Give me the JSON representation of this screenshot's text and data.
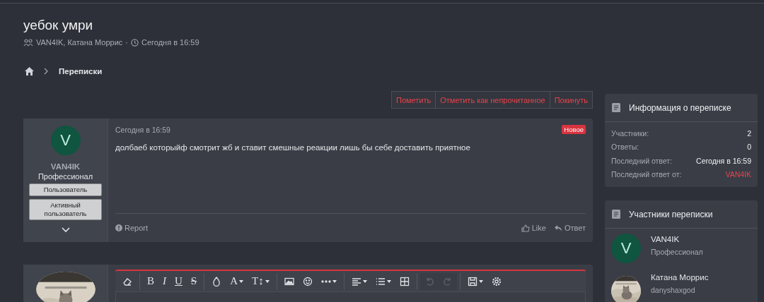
{
  "thread": {
    "title": "уебок умри",
    "participants": "VAN4IK, Катана Моррис",
    "separator": "·",
    "time": "Сегодня в 16:59"
  },
  "breadcrumbs": [
    {
      "label": "Переписки"
    }
  ],
  "actions": [
    {
      "label": "Пометить"
    },
    {
      "label": "Отметить как непрочитанное"
    },
    {
      "label": "Покинуть"
    }
  ],
  "post": {
    "author": {
      "initial": "V",
      "name": "VAN4IK",
      "title": "Профессионал",
      "banners": [
        "Пользователь",
        "Активный пользователь"
      ]
    },
    "time": "Сегодня в 16:59",
    "badge": "Новое",
    "text": "долбаеб которыйф смотрит жб и ставит смешные реакции лишь бы себе доставить приятное",
    "report": "Report",
    "like": "Like",
    "reply": "Ответ"
  },
  "editor": {
    "toolbar": [
      {
        "kind": "icon",
        "disabled": false
      },
      {
        "kind": "sep"
      },
      {
        "kind": "glyph",
        "label": "B",
        "disabled": false
      },
      {
        "kind": "glyph",
        "label": "I",
        "disabled": false
      },
      {
        "kind": "glyph",
        "label": "U",
        "disabled": false
      },
      {
        "kind": "glyph",
        "label": "S",
        "disabled": false
      },
      {
        "kind": "sep"
      },
      {
        "kind": "icon",
        "disabled": false
      },
      {
        "kind": "glyph",
        "label": "A",
        "disabled": false
      },
      {
        "kind": "glyph",
        "label": "T↕",
        "disabled": false
      },
      {
        "kind": "sep"
      },
      {
        "kind": "icon",
        "disabled": false
      },
      {
        "kind": "icon",
        "disabled": false
      },
      {
        "kind": "icon",
        "disabled": false
      },
      {
        "kind": "sep"
      },
      {
        "kind": "icon",
        "disabled": false
      },
      {
        "kind": "icon",
        "disabled": false
      },
      {
        "kind": "icon",
        "disabled": false
      },
      {
        "kind": "sep"
      },
      {
        "kind": "icon",
        "disabled": true
      },
      {
        "kind": "icon",
        "disabled": true
      },
      {
        "kind": "sep"
      },
      {
        "kind": "icon",
        "disabled": false
      },
      {
        "kind": "icon",
        "disabled": false
      }
    ]
  },
  "sidebar": {
    "info": {
      "title": "Информация о переписке",
      "rows": [
        {
          "label": "Участники:",
          "value": "2",
          "kind": "plain"
        },
        {
          "label": "Ответы:",
          "value": "0",
          "kind": "plain"
        },
        {
          "label": "Последний ответ:",
          "value": "Сегодня в 16:59",
          "kind": "plain"
        },
        {
          "label": "Последний ответ от:",
          "value": "VAN4IK",
          "kind": "link"
        }
      ]
    },
    "members": {
      "title": "Участники переписки",
      "items": [
        {
          "name": "VAN4IK",
          "subtitle": "Профессионал",
          "kind": "letter",
          "initial": "V"
        },
        {
          "name": "Катана Моррис",
          "subtitle": "danyshaxgod",
          "kind": "picture"
        }
      ]
    }
  }
}
